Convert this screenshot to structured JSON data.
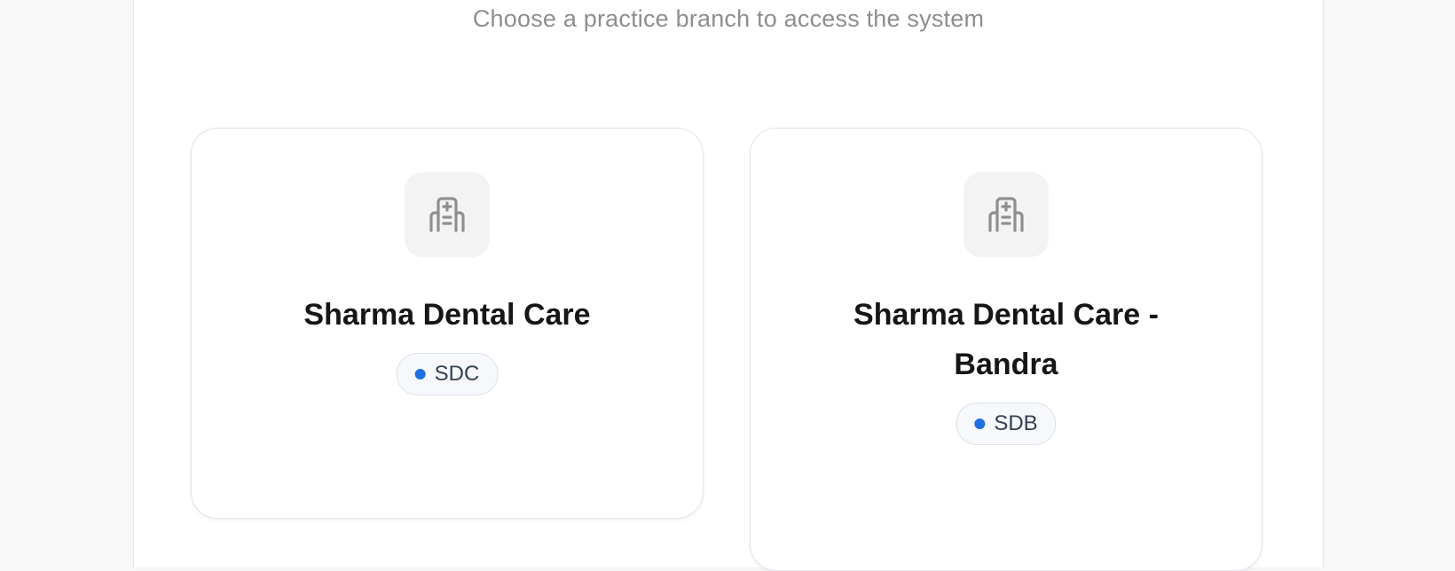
{
  "page": {
    "subtitle": "Choose a practice branch to access the system"
  },
  "branches": [
    {
      "name": "Sharma Dental Care",
      "code": "SDC",
      "icon": "hospital-icon"
    },
    {
      "name": "Sharma Dental Care - Bandra",
      "code": "SDB",
      "icon": "hospital-icon"
    }
  ],
  "colors": {
    "badge_dot": "#1f6fe0",
    "icon_stroke": "#8f8f8f",
    "title_text": "#161616",
    "subtitle_text": "#8e8e8e"
  }
}
